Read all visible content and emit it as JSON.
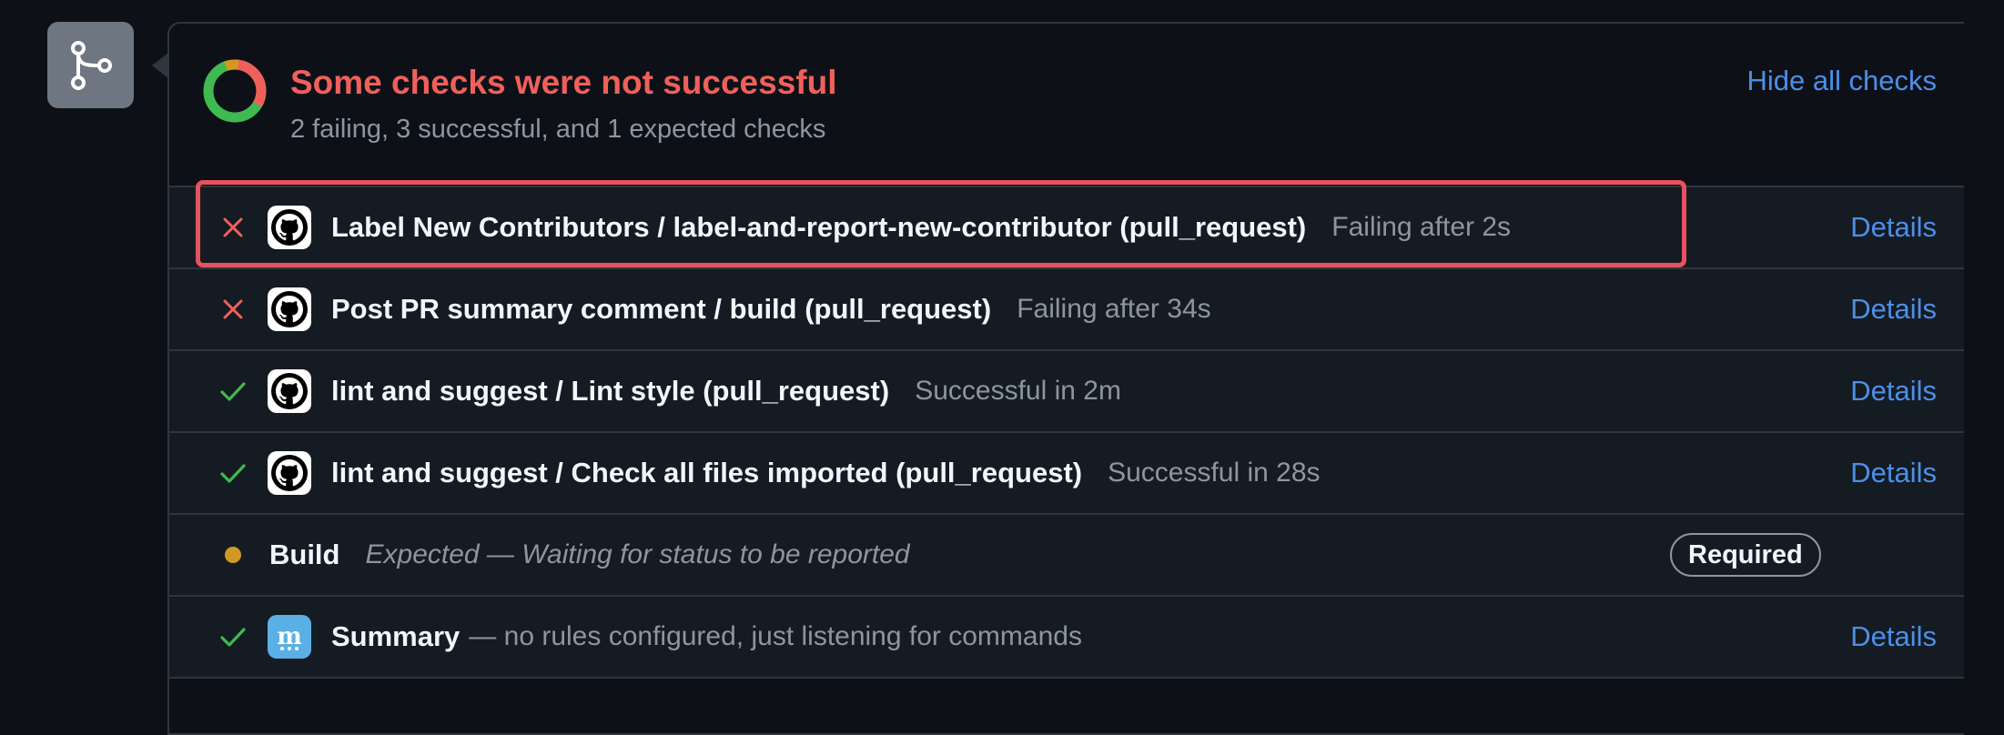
{
  "header": {
    "title": "Some checks were not successful",
    "subtitle": "2 failing, 3 successful, and 1 expected checks",
    "hide_link": "Hide all checks"
  },
  "checks": [
    {
      "state": "failing",
      "icon": "x-icon",
      "avatar": "github-icon",
      "name": "Label New Contributors / label-and-report-new-contributor (pull_request)",
      "status": "Failing after 2s",
      "details": "Details"
    },
    {
      "state": "failing",
      "icon": "x-icon",
      "avatar": "github-icon",
      "name": "Post PR summary comment / build (pull_request)",
      "status": "Failing after 34s",
      "details": "Details"
    },
    {
      "state": "success",
      "icon": "check-icon",
      "avatar": "github-icon",
      "name": "lint and suggest / Lint style (pull_request)",
      "status": "Successful in 2m",
      "details": "Details"
    },
    {
      "state": "success",
      "icon": "check-icon",
      "avatar": "github-icon",
      "name": "lint and suggest / Check all files imported (pull_request)",
      "status": "Successful in 28s",
      "details": "Details"
    },
    {
      "state": "expected",
      "icon": "dot-icon",
      "name": "Build",
      "status": "Expected — Waiting for status to be reported",
      "badge": "Required"
    },
    {
      "state": "success",
      "icon": "check-icon",
      "avatar": "mergify-icon",
      "avatar_letter": "m",
      "name": "Summary",
      "status": "— no rules configured, just listening for commands",
      "details": "Details"
    }
  ],
  "colors": {
    "failing": "#f0605b",
    "success": "#3fb950",
    "expected": "#d29922",
    "link": "#4c8fe8",
    "highlight": "#e8525f"
  }
}
